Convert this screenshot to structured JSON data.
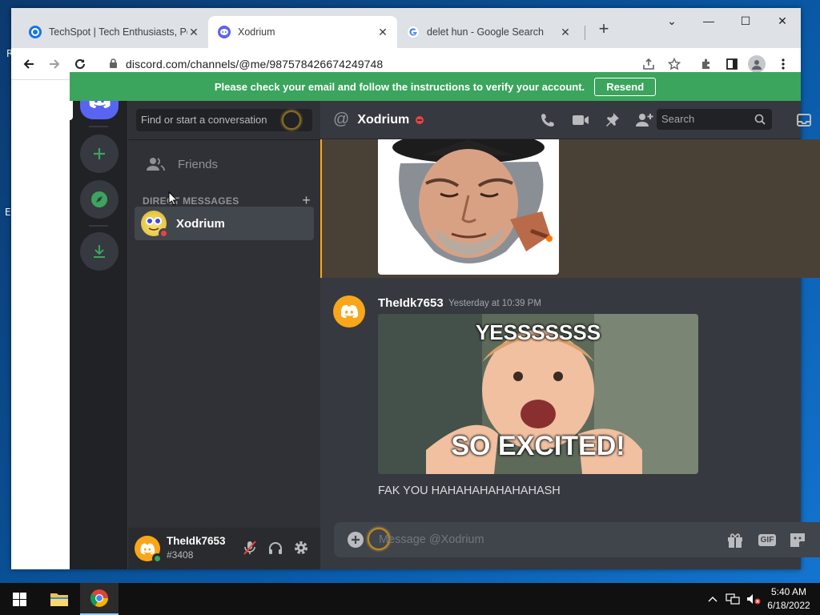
{
  "browser": {
    "tabs": [
      {
        "title": "TechSpot | Tech Enthusiasts, Pow",
        "close": "✕"
      },
      {
        "title": "Xodrium",
        "close": "✕"
      },
      {
        "title": "delet hun - Google Search",
        "close": "✕"
      }
    ],
    "new_tab": "+",
    "url": "discord.com/channels/@me/987578426674249748",
    "window_controls": {
      "minimize": "—",
      "maximize": "☐",
      "close": "✕",
      "tab_search": "⌄"
    }
  },
  "desktop": {
    "letter_r": "R",
    "letter_e": "E"
  },
  "notice": {
    "text": "Please check your email and follow the instructions to verify your account.",
    "button": "Resend"
  },
  "sidebar": {
    "search_placeholder": "Find or start a conversation",
    "friends_label": "Friends",
    "dm_header": "DIRECT MESSAGES",
    "dm_add": "+",
    "dms": [
      {
        "name": "Xodrium"
      }
    ]
  },
  "user_panel": {
    "username": "TheIdk7653",
    "tag": "#3408"
  },
  "chat": {
    "channel_prefix": "@",
    "channel_name": "Xodrium",
    "search_placeholder": "Search",
    "message": {
      "author": "TheIdk7653",
      "timestamp": "Yesterday at 10:39 PM",
      "gif_top_text": "YESSSSSSS",
      "gif_bottom_text": "SO EXCITED!",
      "text": "FAK YOU HAHAHAHAHAHAHASH"
    },
    "input_placeholder": "Message @Xodrium",
    "gif_label": "GIF"
  },
  "taskbar": {
    "time": "5:40 AM",
    "date": "6/18/2022"
  },
  "colors": {
    "blurple": "#5865f2",
    "green": "#3ba55d",
    "red": "#ed4245",
    "highlight": "#faa81a",
    "avatar_orange": "#faa61a"
  },
  "icons": [
    "windows-start-icon",
    "file-explorer-icon",
    "chrome-icon",
    "discord-home-icon",
    "add-server-icon",
    "explore-icon",
    "download-icon",
    "friends-icon",
    "call-icon",
    "video-icon",
    "pin-icon",
    "add-member-icon",
    "inbox-icon",
    "help-icon",
    "mute-icon",
    "headphones-icon",
    "settings-icon",
    "gift-icon",
    "sticker-icon",
    "emoji-icon"
  ]
}
